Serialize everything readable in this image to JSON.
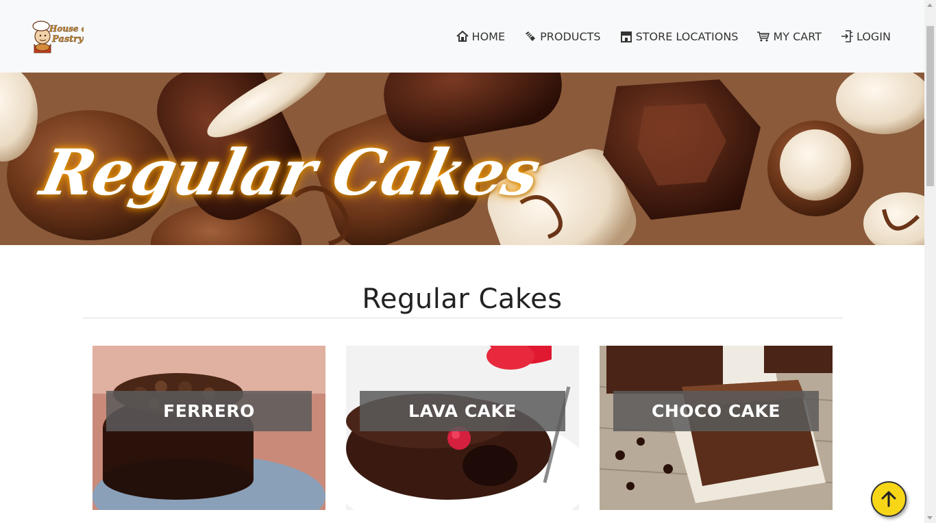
{
  "brand": {
    "logo_text_line1": "House of",
    "logo_text_line2": "Pastry"
  },
  "nav": {
    "home": "HOME",
    "products": "PRODUCTS",
    "store_locations": "STORE LOCATIONS",
    "cart": "MY CART",
    "login": "LOGIN"
  },
  "banner": {
    "title": "Regular Cakes"
  },
  "section": {
    "title": "Regular Cakes"
  },
  "cards": [
    {
      "label": "FERRERO"
    },
    {
      "label": "LAVA CAKE"
    },
    {
      "label": "CHOCO CAKE"
    }
  ],
  "colors": {
    "navbar_bg": "#f8f9fa",
    "accent_yellow": "#f7d618",
    "chocolate": "#5a2e18",
    "glow": "#f5a000"
  }
}
